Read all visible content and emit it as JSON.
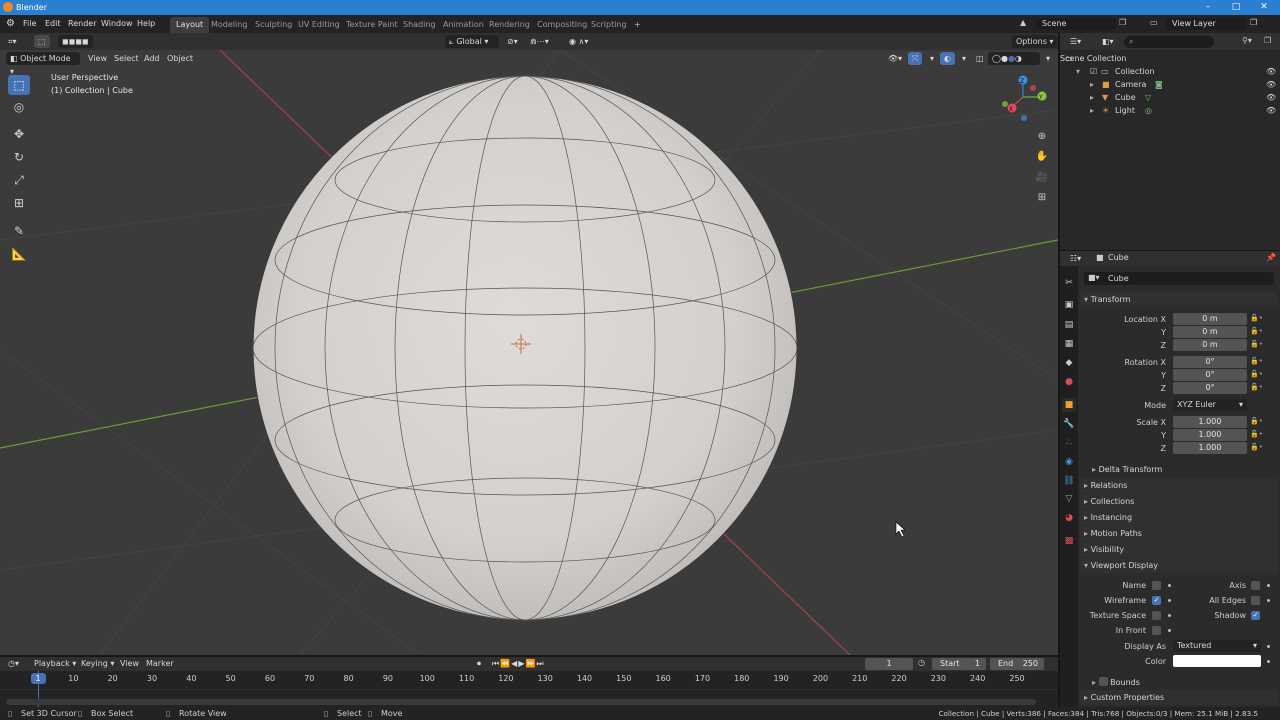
{
  "window": {
    "title": "Blender",
    "controls": [
      "–",
      "□",
      "✕"
    ]
  },
  "menu": [
    "File",
    "Edit",
    "Render",
    "Window",
    "Help"
  ],
  "workspaces": [
    "Layout",
    "Modeling",
    "Sculpting",
    "UV Editing",
    "Texture Paint",
    "Shading",
    "Animation",
    "Rendering",
    "Compositing",
    "Scripting"
  ],
  "active_workspace": "Layout",
  "add_tab": "+",
  "scene": {
    "name": "Scene",
    "view_layer": "View Layer"
  },
  "viewport": {
    "transform_orientation": "Global",
    "options": "Options",
    "mode": "Object Mode",
    "header_menus": [
      "View",
      "Select",
      "Add",
      "Object"
    ],
    "overlay_title": "User Perspective",
    "overlay_subtitle": "(1) Collection | Cube",
    "gizmo_axes": [
      "X",
      "Y",
      "Z"
    ]
  },
  "outliner": {
    "search_placeholder": "",
    "root": "Scene Collection",
    "collection": "Collection",
    "items": [
      "Camera",
      "Cube",
      "Light"
    ]
  },
  "properties": {
    "object_name": "Cube",
    "data_name": "Cube",
    "transform": {
      "title": "Transform",
      "location_label": "Location X",
      "location": [
        "0 m",
        "0 m",
        "0 m"
      ],
      "rotation_label": "Rotation X",
      "rotation": [
        "0°",
        "0°",
        "0°"
      ],
      "mode_label": "Mode",
      "mode": "XYZ Euler",
      "scale_label": "Scale X",
      "scale": [
        "1.000",
        "1.000",
        "1.000"
      ],
      "axis_y": "Y",
      "axis_z": "Z",
      "delta": "Delta Transform"
    },
    "panels": [
      "Relations",
      "Collections",
      "Instancing",
      "Motion Paths",
      "Visibility"
    ],
    "viewport_display": {
      "title": "Viewport Display",
      "name": "Name",
      "axis": "Axis",
      "wireframe": "Wireframe",
      "all_edges": "All Edges",
      "texture_space": "Texture Space",
      "shadow": "Shadow",
      "in_front": "In Front",
      "display_as_label": "Display As",
      "display_as": "Textured",
      "color_label": "Color",
      "bounds": "Bounds"
    },
    "custom_properties": "Custom Properties"
  },
  "timeline": {
    "menus": [
      "Playback",
      "Keying",
      "View",
      "Marker"
    ],
    "current_frame": "1",
    "start_label": "Start",
    "start": "1",
    "end_label": "End",
    "end": "250",
    "ruler_ticks": [
      "1",
      "10",
      "20",
      "30",
      "40",
      "50",
      "60",
      "70",
      "80",
      "90",
      "100",
      "110",
      "120",
      "130",
      "140",
      "150",
      "160",
      "170",
      "180",
      "190",
      "200",
      "210",
      "220",
      "230",
      "240",
      "250"
    ]
  },
  "statusbar": {
    "left": [
      "Set 3D Cursor",
      "Box Select",
      "Rotate View",
      "Select",
      "Move"
    ],
    "right": "Collection | Cube | Verts:386 | Faces:384 | Tris:768 | Objects:0/3 | Mem: 25.1 MiB | 2.83.5"
  },
  "colors": {
    "accent": "#4772b3",
    "titlebar": "#2b7fd1",
    "x_axis": "#e04a5c",
    "y_axis": "#8cc63f",
    "z_axis": "#3d8ee6"
  }
}
